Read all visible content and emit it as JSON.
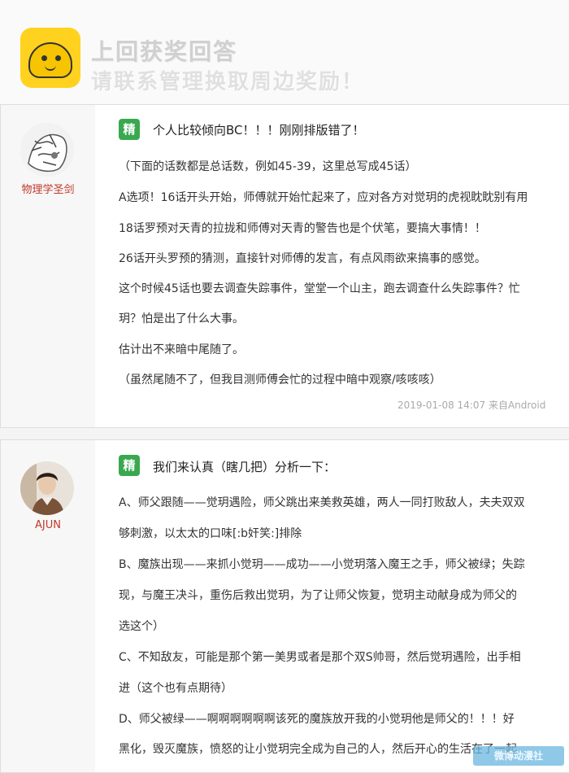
{
  "banner": {
    "line1": "上回获奖回答",
    "line2": "请联系管理换取周边奖励！"
  },
  "posts": [
    {
      "username": "物理学圣剑",
      "badge": "精",
      "title": "个人比较倾向BC！！！刚刚排版错了！",
      "lines": [
        "（下面的话数都是总话数，例如45-39，这里总写成45话）",
        "A选项！16话开头开始，师傅就开始忙起来了，应对各方对觉玥的虎视眈眈别有用",
        "18话罗预对天青的拉拢和师傅对天青的警告也是个伏笔，要搞大事情！！",
        "26话开头罗预的猜测，直接针对师傅的发言，有点风雨欲来搞事的感觉。",
        "这个时候45话也要去调查失踪事件，堂堂一个山主，跑去调查什么失踪事件？忙",
        "玥？怕是出了什么大事。",
        "估计出不来暗中尾随了。",
        "（虽然尾随不了，但我目测师傅会忙的过程中暗中观察/咳咳咳）"
      ],
      "meta": "2019-01-08 14:07 来自Android"
    },
    {
      "username": "AJUN",
      "badge": "精",
      "title": "我们来认真（瞎几把）分析一下：",
      "lines": [
        "A、师父跟随——觉玥遇险，师父跳出来美救英雄，两人一同打败敌人，夫夫双双",
        "够刺激，以太太的口味[:b奸笑:]排除",
        "B、魔族出现——来抓小觉玥——成功——小觉玥落入魔王之手，师父被绿；失踪",
        "现，与魔王决斗，重伤后救出觉玥，为了让师父恢复，觉玥主动献身成为师父的",
        "选这个）",
        "C、不知敌友，可能是那个第一美男或者是那个双S帅哥，然后觉玥遇险，出手相",
        "进（这个也有点期待）",
        "D、师父被绿——啊啊啊啊啊啊该死的魔族放开我的小觉玥他是师父的！！！好",
        "黑化，毁灭魔族，愤怒的让小觉玥完全成为自己的人，然后开心的生活在了一起"
      ]
    }
  ],
  "watermark": "微博动漫社"
}
